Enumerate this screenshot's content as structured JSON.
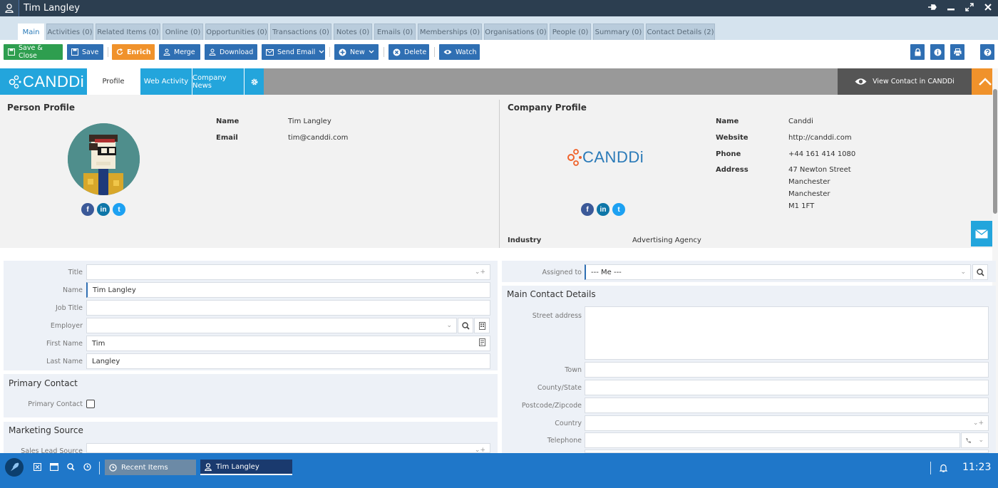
{
  "window": {
    "title": "Tim Langley"
  },
  "tabs": [
    {
      "label": "Main"
    },
    {
      "label": "Activities (0)"
    },
    {
      "label": "Related Items (0)"
    },
    {
      "label": "Online (0)"
    },
    {
      "label": "Opportunities (0)"
    },
    {
      "label": "Transactions (0)"
    },
    {
      "label": "Notes (0)"
    },
    {
      "label": "Emails (0)"
    },
    {
      "label": "Memberships (0)"
    },
    {
      "label": "Organisations (0)"
    },
    {
      "label": "People (0)"
    },
    {
      "label": "Summary (0)"
    },
    {
      "label": "Contact Details (2)"
    }
  ],
  "toolbar": {
    "save_close": "Save & Close",
    "save": "Save",
    "enrich": "Enrich",
    "merge": "Merge",
    "download": "Download",
    "send_email": "Send Email",
    "new": "New",
    "delete": "Delete",
    "watch": "Watch"
  },
  "candi": {
    "logo": "CANDDi",
    "tab_profile": "Profile",
    "tab_web_activity": "Web Activity",
    "tab_company_news": "Company News",
    "view_contact": "View Contact in CANDDi"
  },
  "person_profile": {
    "heading": "Person Profile",
    "name_label": "Name",
    "name": "Tim Langley",
    "email_label": "Email",
    "email": "tim@canddi.com"
  },
  "company_profile": {
    "heading": "Company Profile",
    "logo": "CANDDi",
    "name_label": "Name",
    "name": "Canddi",
    "website_label": "Website",
    "website": "http://canddi.com",
    "phone_label": "Phone",
    "phone": "+44 161 414 1080",
    "address_label": "Address",
    "address": [
      "47 Newton Street",
      "Manchester",
      "Manchester",
      "M1 1FT"
    ],
    "industry_label": "Industry",
    "industry": "Advertising Agency"
  },
  "social": {
    "facebook": "f",
    "linkedin": "in",
    "twitter": "t"
  },
  "form_left": {
    "title_label": "Title",
    "title_value": "",
    "name_label": "Name",
    "name_value": "Tim Langley",
    "job_title_label": "Job Title",
    "job_title_value": "",
    "employer_label": "Employer",
    "employer_value": "",
    "first_name_label": "First Name",
    "first_name_value": "Tim",
    "last_name_label": "Last Name",
    "last_name_value": "Langley",
    "primary_contact_heading": "Primary Contact",
    "primary_contact_label": "Primary Contact",
    "marketing_source_heading": "Marketing Source",
    "sales_lead_source_label": "Sales Lead Source"
  },
  "form_right": {
    "assigned_to_label": "Assigned to",
    "assigned_to_value": "--- Me ---",
    "main_contact_heading": "Main Contact Details",
    "street_label": "Street address",
    "town_label": "Town",
    "county_label": "County/State",
    "postcode_label": "Postcode/Zipcode",
    "country_label": "Country",
    "telephone_label": "Telephone"
  },
  "taskbar": {
    "recent_items": "Recent Items",
    "current_item": "Tim Langley",
    "time": "11:23"
  }
}
